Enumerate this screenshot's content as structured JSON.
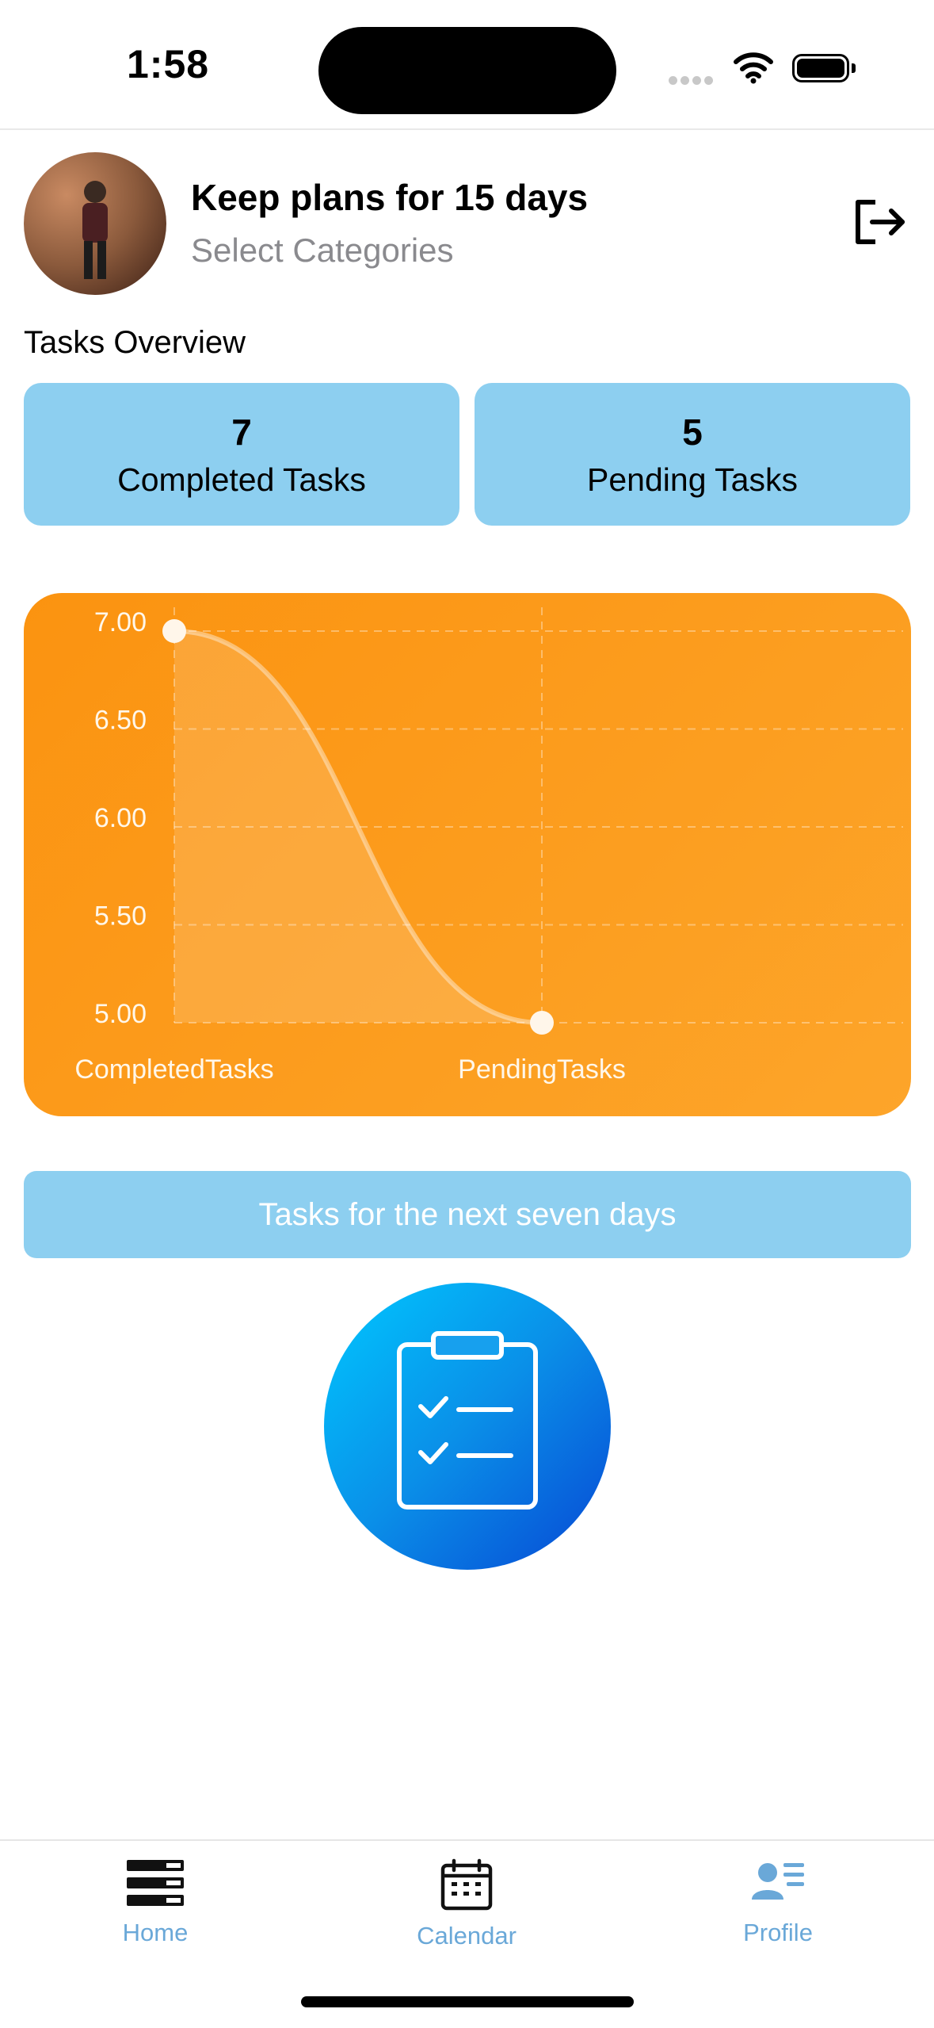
{
  "status_bar": {
    "time": "1:58"
  },
  "header": {
    "title": "Keep plans for 15 days",
    "subtitle": "Select Categories"
  },
  "overview": {
    "label": "Tasks Overview",
    "completed": {
      "value": "7",
      "label": "Completed Tasks"
    },
    "pending": {
      "value": "5",
      "label": "Pending Tasks"
    }
  },
  "chart_data": {
    "type": "line",
    "categories": [
      "CompletedTasks",
      "PendingTasks"
    ],
    "series": [
      {
        "values": [
          7,
          5
        ]
      }
    ],
    "ylim": [
      5.0,
      7.0
    ],
    "yticks": [
      "7.00",
      "6.50",
      "6.00",
      "5.50",
      "5.00"
    ],
    "grid": true,
    "area_fill": true,
    "colors": {
      "background": "#fb9310",
      "line": "#ffffff"
    }
  },
  "next_button": {
    "label": "Tasks for the next seven days"
  },
  "tabbar": {
    "items": [
      {
        "label": "Home",
        "icon": "home-icon"
      },
      {
        "label": "Calendar",
        "icon": "calendar-icon"
      },
      {
        "label": "Profile",
        "icon": "profile-icon"
      }
    ]
  },
  "colors": {
    "accent_blue": "#8dcff0",
    "tab_label": "#6aa8d8",
    "chart_orange": "#fb9310"
  }
}
